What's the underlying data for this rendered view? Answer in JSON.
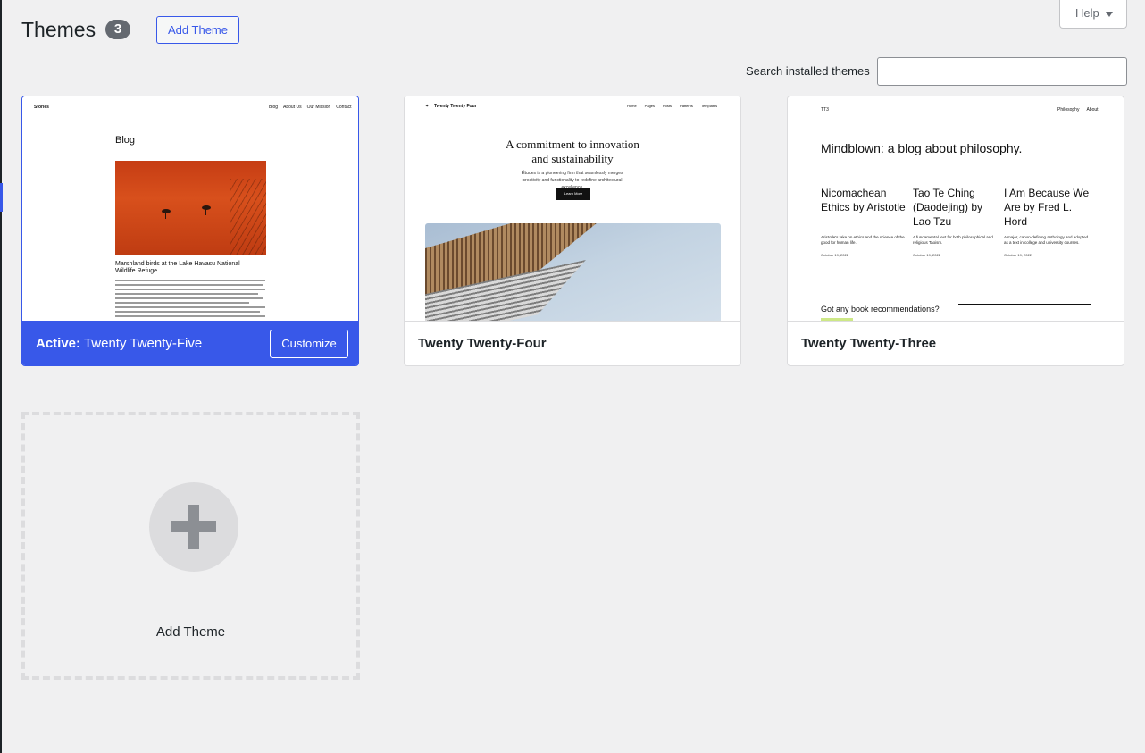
{
  "header": {
    "title": "Themes",
    "count": "3",
    "add_button": "Add Theme",
    "help_label": "Help"
  },
  "search": {
    "label": "Search installed themes",
    "value": "",
    "placeholder": ""
  },
  "themes": [
    {
      "active_prefix": "Active:",
      "name": "Twenty Twenty-Five",
      "action": "Customize",
      "preview": {
        "site_title": "Stories",
        "nav": [
          "Blog",
          "About Us",
          "Our Mission",
          "Contact"
        ],
        "heading": "Blog",
        "post_title": "Marshland birds at the Lake Havasu National Wildlife Refuge"
      }
    },
    {
      "name": "Twenty Twenty-Four",
      "preview": {
        "site_title": "Twenty Twenty Four",
        "nav": [
          "Home",
          "Pages",
          "Posts",
          "Patterns",
          "Templates"
        ],
        "heading": "A commitment to innovation and sustainability",
        "subheading": "Études is a pioneering firm that seamlessly merges creativity and functionality to redefine architectural excellence.",
        "button": "Learn More"
      }
    },
    {
      "name": "Twenty Twenty-Three",
      "preview": {
        "site_title": "TT3",
        "nav": [
          "Philosophy",
          "About"
        ],
        "heading": "Mindblown: a blog about philosophy.",
        "posts": [
          {
            "title": "Nicomachean Ethics by Aristotle",
            "desc": "Aristotle's take on ethics and the science of the good for human life.",
            "date": "October 19, 2022"
          },
          {
            "title": "Tao Te Ching (Daodejing) by Lao Tzu",
            "desc": "A fundamental text for both philosophical and religious Taoism.",
            "date": "October 19, 2022"
          },
          {
            "title": "I Am Because We Are by Fred L. Hord",
            "desc": "A major, canon-defining anthology and adopted as a text in college and university courses.",
            "date": "October 19, 2022"
          }
        ],
        "footer_question": "Got any book recommendations?"
      }
    }
  ],
  "add_new": {
    "label": "Add Theme",
    "icon": "plus-icon"
  },
  "colors": {
    "accent": "#3858e9",
    "background": "#f0f0f1",
    "badge": "#646970"
  }
}
